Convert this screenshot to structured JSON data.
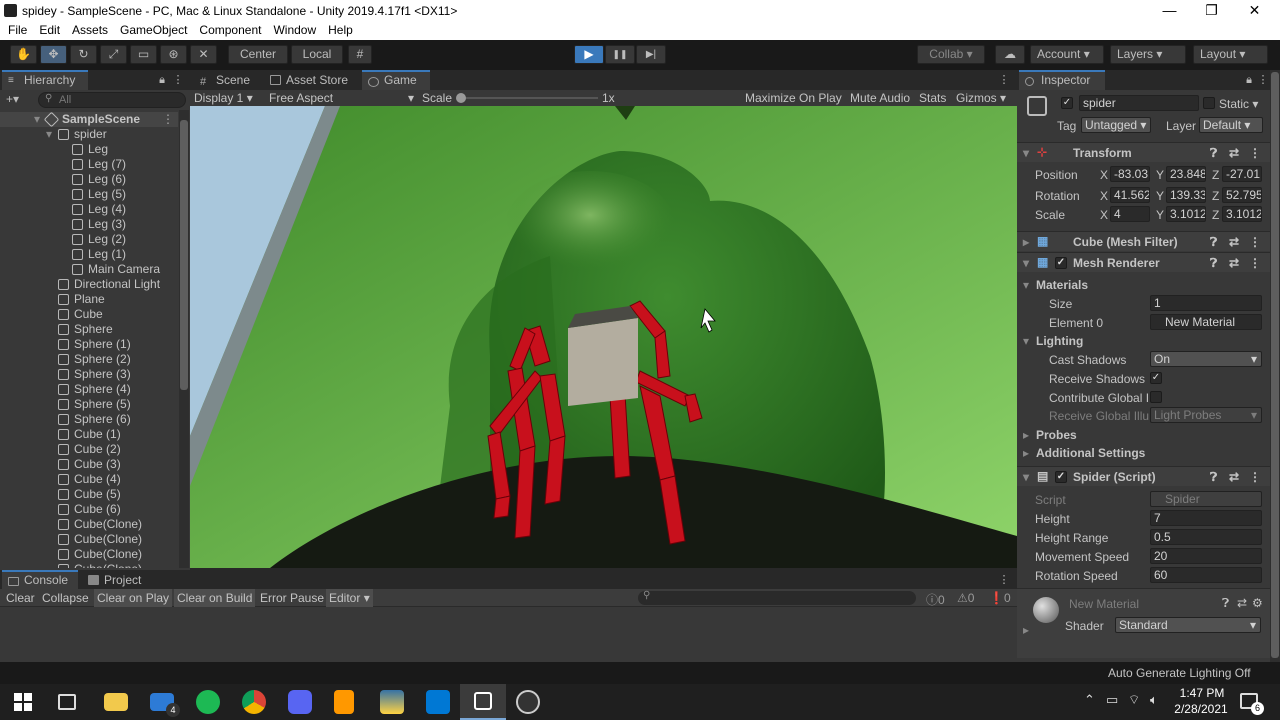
{
  "window": {
    "title": "spidey - SampleScene - PC, Mac & Linux Standalone - Unity 2019.4.17f1 <DX11>",
    "minimize": "—",
    "maximize": "❐",
    "close": "✕"
  },
  "menu": [
    "File",
    "Edit",
    "Assets",
    "GameObject",
    "Component",
    "Window",
    "Help"
  ],
  "toolbar": {
    "center": "Center",
    "local": "Local",
    "collab": "Collab",
    "account": "Account",
    "layers": "Layers",
    "layout": "Layout",
    "play": "▶",
    "pause": "❚❚",
    "step": "▶|"
  },
  "hierarchy": {
    "tab": "Hierarchy",
    "add": "+▾",
    "search_placeholder": "All",
    "scene": "SampleScene",
    "items": [
      {
        "label": "spider",
        "indent": 1,
        "arrow": "▾"
      },
      {
        "label": "Leg",
        "indent": 2
      },
      {
        "label": "Leg (7)",
        "indent": 2
      },
      {
        "label": "Leg (6)",
        "indent": 2
      },
      {
        "label": "Leg (5)",
        "indent": 2
      },
      {
        "label": "Leg (4)",
        "indent": 2
      },
      {
        "label": "Leg (3)",
        "indent": 2
      },
      {
        "label": "Leg (2)",
        "indent": 2
      },
      {
        "label": "Leg (1)",
        "indent": 2
      },
      {
        "label": "Main Camera",
        "indent": 2
      },
      {
        "label": "Directional Light",
        "indent": 1
      },
      {
        "label": "Plane",
        "indent": 1
      },
      {
        "label": "Cube",
        "indent": 1
      },
      {
        "label": "Sphere",
        "indent": 1
      },
      {
        "label": "Sphere (1)",
        "indent": 1
      },
      {
        "label": "Sphere (2)",
        "indent": 1
      },
      {
        "label": "Sphere (3)",
        "indent": 1
      },
      {
        "label": "Sphere (4)",
        "indent": 1
      },
      {
        "label": "Sphere (5)",
        "indent": 1
      },
      {
        "label": "Sphere (6)",
        "indent": 1
      },
      {
        "label": "Cube (1)",
        "indent": 1
      },
      {
        "label": "Cube (2)",
        "indent": 1
      },
      {
        "label": "Cube (3)",
        "indent": 1
      },
      {
        "label": "Cube (4)",
        "indent": 1
      },
      {
        "label": "Cube (5)",
        "indent": 1
      },
      {
        "label": "Cube (6)",
        "indent": 1
      },
      {
        "label": "Cube(Clone)",
        "indent": 1
      },
      {
        "label": "Cube(Clone)",
        "indent": 1
      },
      {
        "label": "Cube(Clone)",
        "indent": 1
      },
      {
        "label": "Cube(Clone)",
        "indent": 1
      }
    ]
  },
  "game": {
    "tabs": {
      "scene": "Scene",
      "asset_store": "Asset Store",
      "game": "Game"
    },
    "display": "Display 1",
    "aspect": "Free Aspect",
    "scale_label": "Scale",
    "scale_value": "1x",
    "maximize": "Maximize On Play",
    "mute": "Mute Audio",
    "stats": "Stats",
    "gizmos": "Gizmos"
  },
  "inspector": {
    "tab": "Inspector",
    "object_name": "spider",
    "static": "Static",
    "tag_label": "Tag",
    "tag_value": "Untagged",
    "layer_label": "Layer",
    "layer_value": "Default",
    "transform": {
      "title": "Transform",
      "position": {
        "label": "Position",
        "x": "-83.03",
        "y": "23.848",
        "z": "-27.01"
      },
      "rotation": {
        "label": "Rotation",
        "x": "41.562",
        "y": "139.33",
        "z": "52.795"
      },
      "scale": {
        "label": "Scale",
        "x": "4",
        "y": "3.1012",
        "z": "3.1012"
      }
    },
    "mesh_filter": "Cube (Mesh Filter)",
    "mesh_renderer": "Mesh Renderer",
    "materials": {
      "title": "Materials",
      "size_label": "Size",
      "size_value": "1",
      "element_label": "Element 0",
      "element_value": "New Material"
    },
    "lighting": {
      "title": "Lighting",
      "cast_label": "Cast Shadows",
      "cast_value": "On",
      "receive_label": "Receive Shadows",
      "contrib_label": "Contribute Global I",
      "receive_gi_label": "Receive Global Illu",
      "receive_gi_value": "Light Probes"
    },
    "probes": "Probes",
    "additional": "Additional Settings",
    "script": {
      "title": "Spider (Script)",
      "script_label": "Script",
      "script_value": "Spider",
      "fields": [
        {
          "label": "Height",
          "value": "7"
        },
        {
          "label": "Height Range",
          "value": "0.5"
        },
        {
          "label": "Movement Speed",
          "value": "20"
        },
        {
          "label": "Rotation Speed",
          "value": "60"
        }
      ]
    },
    "material": {
      "name": "New Material",
      "shader_label": "Shader",
      "shader_value": "Standard"
    }
  },
  "console": {
    "tab_console": "Console",
    "tab_project": "Project",
    "clear": "Clear",
    "collapse": "Collapse",
    "clear_on_play": "Clear on Play",
    "clear_on_build": "Clear on Build",
    "error_pause": "Error Pause",
    "editor": "Editor",
    "count_info": "0",
    "count_warn": "0",
    "count_err": "0"
  },
  "status": {
    "text": "Auto Generate Lighting Off"
  },
  "taskbar": {
    "time": "1:47 PM",
    "date": "2/28/2021",
    "mail_badge": "4",
    "notif_badge": "6"
  },
  "colors": {
    "accent": "#3a79bb",
    "spider_leg": "#c8101c",
    "grass": "#5aa83e"
  }
}
